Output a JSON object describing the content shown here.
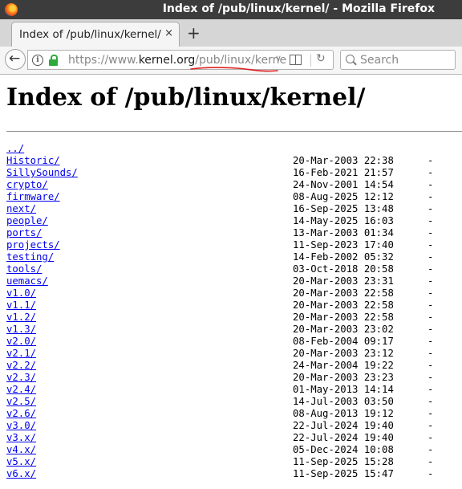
{
  "window": {
    "title": "Index of /pub/linux/kernel/ - Mozilla Firefox"
  },
  "tabs": [
    {
      "label": "Index of /pub/linux/kernel/",
      "close": "×"
    }
  ],
  "new_tab": "+",
  "navbar": {
    "url_prefix": "https://www.",
    "url_domain": "kernel.org",
    "url_path": "/pub/linux/kerne",
    "search_placeholder": "Search",
    "annotation_color": "#e02020"
  },
  "page": {
    "heading": "Index of /pub/linux/kernel/",
    "parent": "../",
    "entries": [
      {
        "name": "Historic/",
        "date": "20-Mar-2003 22:38",
        "size": "-"
      },
      {
        "name": "SillySounds/",
        "date": "16-Feb-2021 21:57",
        "size": "-"
      },
      {
        "name": "crypto/",
        "date": "24-Nov-2001 14:54",
        "size": "-"
      },
      {
        "name": "firmware/",
        "date": "08-Aug-2025 12:12",
        "size": "-"
      },
      {
        "name": "next/",
        "date": "16-Sep-2025 13:48",
        "size": "-"
      },
      {
        "name": "people/",
        "date": "14-May-2025 16:03",
        "size": "-"
      },
      {
        "name": "ports/",
        "date": "13-Mar-2003 01:34",
        "size": "-"
      },
      {
        "name": "projects/",
        "date": "11-Sep-2023 17:40",
        "size": "-"
      },
      {
        "name": "testing/",
        "date": "14-Feb-2002 05:32",
        "size": "-"
      },
      {
        "name": "tools/",
        "date": "03-Oct-2018 20:58",
        "size": "-"
      },
      {
        "name": "uemacs/",
        "date": "20-Mar-2003 23:31",
        "size": "-"
      },
      {
        "name": "v1.0/",
        "date": "20-Mar-2003 22:58",
        "size": "-"
      },
      {
        "name": "v1.1/",
        "date": "20-Mar-2003 22:58",
        "size": "-"
      },
      {
        "name": "v1.2/",
        "date": "20-Mar-2003 22:58",
        "size": "-"
      },
      {
        "name": "v1.3/",
        "date": "20-Mar-2003 23:02",
        "size": "-"
      },
      {
        "name": "v2.0/",
        "date": "08-Feb-2004 09:17",
        "size": "-"
      },
      {
        "name": "v2.1/",
        "date": "20-Mar-2003 23:12",
        "size": "-"
      },
      {
        "name": "v2.2/",
        "date": "24-Mar-2004 19:22",
        "size": "-"
      },
      {
        "name": "v2.3/",
        "date": "20-Mar-2003 23:23",
        "size": "-"
      },
      {
        "name": "v2.4/",
        "date": "01-May-2013 14:14",
        "size": "-"
      },
      {
        "name": "v2.5/",
        "date": "14-Jul-2003 03:50",
        "size": "-"
      },
      {
        "name": "v2.6/",
        "date": "08-Aug-2013 19:12",
        "size": "-"
      },
      {
        "name": "v3.0/",
        "date": "22-Jul-2024 19:40",
        "size": "-"
      },
      {
        "name": "v3.x/",
        "date": "22-Jul-2024 19:40",
        "size": "-"
      },
      {
        "name": "v4.x/",
        "date": "05-Dec-2024 10:08",
        "size": "-"
      },
      {
        "name": "v5.x/",
        "date": "11-Sep-2025 15:28",
        "size": "-"
      },
      {
        "name": "v6.x/",
        "date": "11-Sep-2025 15:47",
        "size": "-"
      }
    ]
  }
}
